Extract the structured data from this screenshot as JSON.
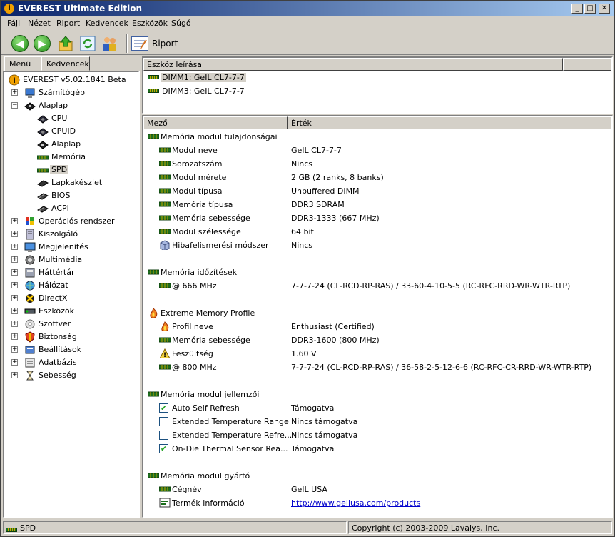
{
  "window": {
    "title": "EVEREST Ultimate Edition",
    "minimize": "_",
    "maximize": "□",
    "close": "✕"
  },
  "menu": [
    "Fájl",
    "Nézet",
    "Riport",
    "Kedvencek",
    "Eszközök",
    "Súgó"
  ],
  "toolbar": {
    "report_label": "Riport"
  },
  "tabs": {
    "menu": "Menü",
    "favorites": "Kedvencek"
  },
  "tree": {
    "root": "EVEREST v5.02.1841 Beta",
    "items": [
      {
        "label": "Számítógép",
        "icon": "computer-icon"
      },
      {
        "label": "Alaplap",
        "icon": "motherboard-icon"
      },
      {
        "label": "CPU",
        "icon": "cpu-icon"
      },
      {
        "label": "CPUID",
        "icon": "cpu-icon"
      },
      {
        "label": "Alaplap",
        "icon": "motherboard-icon"
      },
      {
        "label": "Memória",
        "icon": "memory-icon"
      },
      {
        "label": "SPD",
        "icon": "memory-icon"
      },
      {
        "label": "Lapkakészlet",
        "icon": "chipset-icon"
      },
      {
        "label": "BIOS",
        "icon": "chip-icon"
      },
      {
        "label": "ACPI",
        "icon": "chip-icon"
      },
      {
        "label": "Operációs rendszer",
        "icon": "windows-icon"
      },
      {
        "label": "Kiszolgáló",
        "icon": "server-icon"
      },
      {
        "label": "Megjelenítés",
        "icon": "display-icon"
      },
      {
        "label": "Multimédia",
        "icon": "speaker-icon"
      },
      {
        "label": "Háttértár",
        "icon": "storage-icon"
      },
      {
        "label": "Hálózat",
        "icon": "network-icon"
      },
      {
        "label": "DirectX",
        "icon": "directx-icon"
      },
      {
        "label": "Eszközök",
        "icon": "devices-icon"
      },
      {
        "label": "Szoftver",
        "icon": "software-icon"
      },
      {
        "label": "Biztonság",
        "icon": "security-icon"
      },
      {
        "label": "Beállítások",
        "icon": "settings-icon"
      },
      {
        "label": "Adatbázis",
        "icon": "database-icon"
      },
      {
        "label": "Sebesség",
        "icon": "hourglass-icon"
      }
    ]
  },
  "device_panel": {
    "header": "Eszköz leírása",
    "devices": [
      "DIMM1: GeIL CL7-7-7",
      "DIMM3: GeIL CL7-7-7"
    ]
  },
  "detail": {
    "col_field": "Mező",
    "col_value": "Érték",
    "sections": [
      {
        "title": "Memória modul tulajdonságai",
        "rows": [
          {
            "field": "Modul neve",
            "value": "GeIL CL7-7-7"
          },
          {
            "field": "Sorozatszám",
            "value": "Nincs"
          },
          {
            "field": "Modul mérete",
            "value": "2 GB (2 ranks, 8 banks)"
          },
          {
            "field": "Modul típusa",
            "value": "Unbuffered DIMM"
          },
          {
            "field": "Memória típusa",
            "value": "DDR3 SDRAM"
          },
          {
            "field": "Memória sebessége",
            "value": "DDR3-1333 (667 MHz)"
          },
          {
            "field": "Modul szélessége",
            "value": "64 bit"
          },
          {
            "field": "Hibafelismerési módszer",
            "value": "Nincs"
          }
        ]
      },
      {
        "title": "Memória időzítések",
        "rows": [
          {
            "field": "@ 666 MHz",
            "value": "7-7-7-24  (CL-RCD-RP-RAS) / 33-60-4-10-5-5  (RC-RFC-RRD-WR-WTR-RTP)"
          }
        ]
      },
      {
        "title": "Extreme Memory Profile",
        "rows": [
          {
            "field": "Profil neve",
            "value": "Enthusiast (Certified)"
          },
          {
            "field": "Memória sebessége",
            "value": "DDR3-1600 (800 MHz)"
          },
          {
            "field": "Feszültség",
            "value": "1.60 V"
          },
          {
            "field": "@ 800 MHz",
            "value": "7-7-7-24  (CL-RCD-RP-RAS) / 36-58-2-5-12-6-6  (RC-RFC-CR-RRD-WR-WTR-RTP)"
          }
        ]
      },
      {
        "title": "Memória modul jellemzői",
        "rows": [
          {
            "field": "Auto Self Refresh",
            "value": "Támogatva"
          },
          {
            "field": "Extended Temperature Range",
            "value": "Nincs támogatva"
          },
          {
            "field": "Extended Temperature Refre...",
            "value": "Nincs támogatva"
          },
          {
            "field": "On-Die Thermal Sensor Rea...",
            "value": "Támogatva"
          }
        ]
      },
      {
        "title": "Memória modul gyártó",
        "rows": [
          {
            "field": "Cégnév",
            "value": "GeIL USA"
          },
          {
            "field": "Termék információ",
            "value": "http://www.geilusa.com/products"
          }
        ]
      }
    ]
  },
  "status": {
    "left": "SPD",
    "right": "Copyright (c) 2003-2009 Lavalys, Inc."
  }
}
